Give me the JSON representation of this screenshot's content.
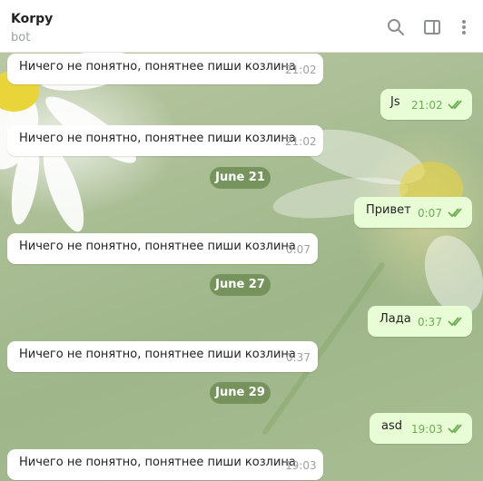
{
  "header": {
    "title": "Korpy",
    "subtitle": "bot",
    "icons": [
      "search-icon",
      "sidebar-toggle-icon",
      "more-vertical-icon"
    ]
  },
  "colors": {
    "incoming_bubble": "#ffffff",
    "outgoing_bubble": "#e8fdd5",
    "date_pill": "#6e8c55",
    "check_color": "#6cae55"
  },
  "messages": [
    {
      "direction": "in",
      "text": "Ничего не понятно, понятнее пиши козлина",
      "time": "21:02"
    },
    {
      "direction": "out",
      "text": "Js",
      "time": "21:02",
      "status": "read"
    },
    {
      "direction": "in",
      "text": "Ничего не понятно, понятнее пиши козлина",
      "time": "21:02"
    },
    {
      "type": "date",
      "text": "June 21"
    },
    {
      "direction": "out",
      "text": "Привет",
      "time": "0:07",
      "status": "read"
    },
    {
      "direction": "in",
      "text": "Ничего не понятно, понятнее пиши козлина",
      "time": "0:07"
    },
    {
      "type": "date",
      "text": "June 27"
    },
    {
      "direction": "out",
      "text": "Лада",
      "time": "0:37",
      "status": "read"
    },
    {
      "direction": "in",
      "text": "Ничего не понятно, понятнее пиши козлина",
      "time": "0:37"
    },
    {
      "type": "date",
      "text": "June 29"
    },
    {
      "direction": "out",
      "text": "asd",
      "time": "19:03",
      "status": "read"
    },
    {
      "direction": "in",
      "text": "Ничего не понятно, понятнее пиши козлина",
      "time": "19:03"
    }
  ]
}
